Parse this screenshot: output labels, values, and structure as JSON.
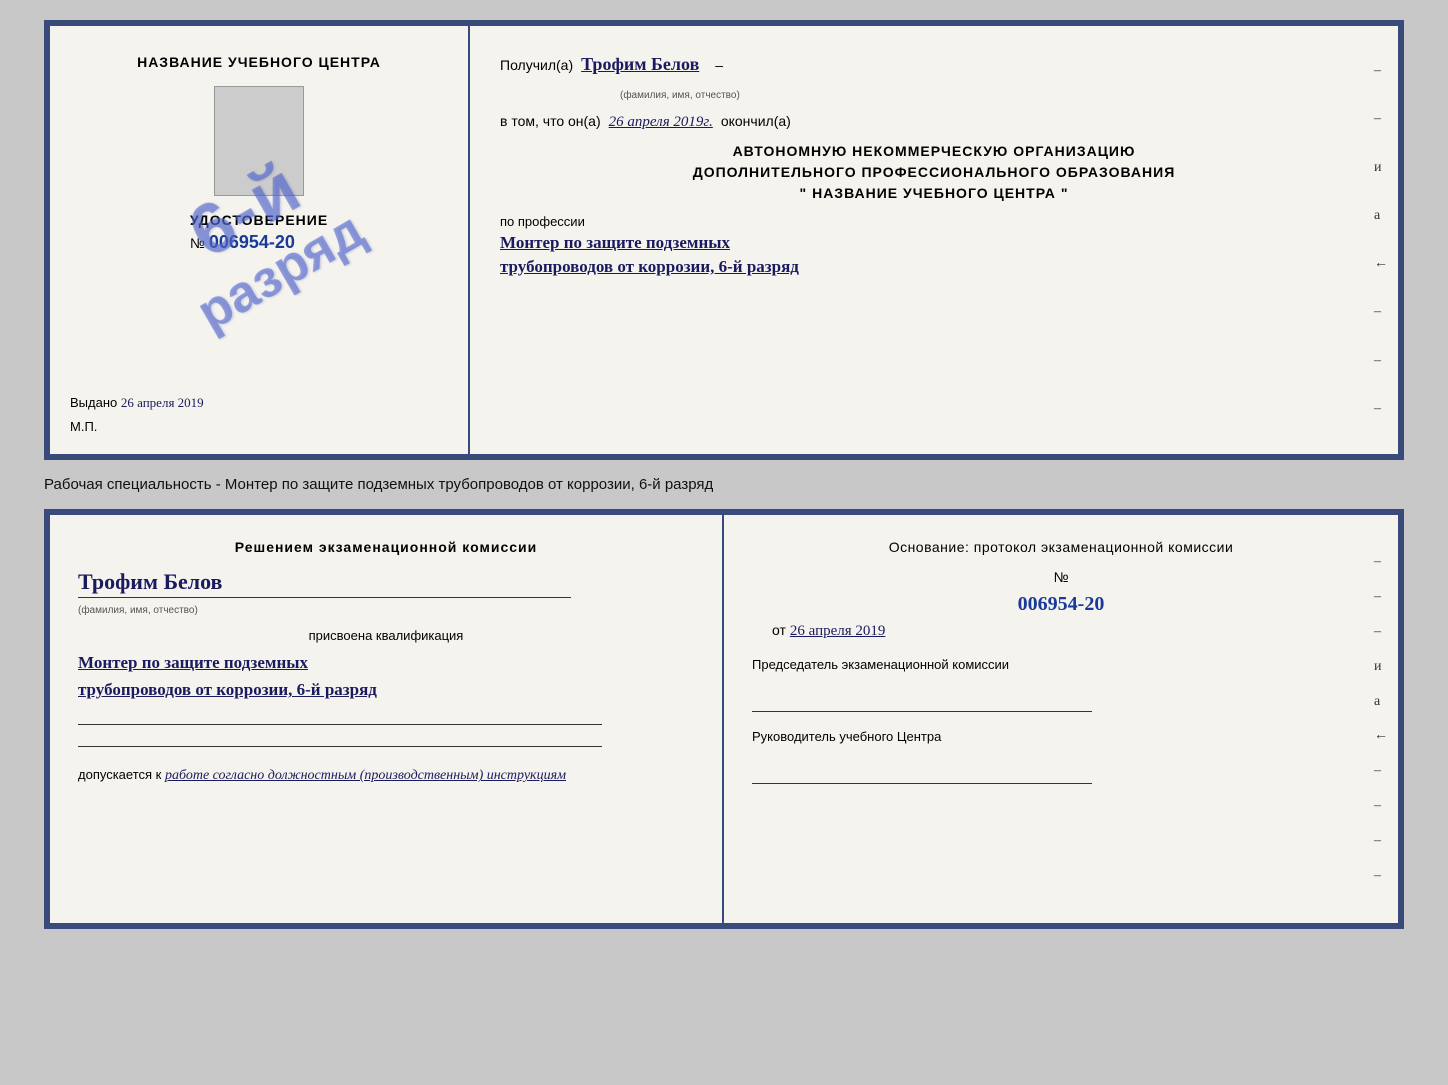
{
  "top_cert": {
    "left": {
      "title": "НАЗВАНИЕ УЧЕБНОГО ЦЕНТРА",
      "udost_title": "УДОСТОВЕРЕНИЕ",
      "udost_no_prefix": "№",
      "udost_no": "006954-20",
      "vydano_label": "Выдано",
      "vydano_date": "26 апреля 2019",
      "mp_label": "М.П."
    },
    "stamp": {
      "line1": "6-й",
      "line2": "разряд"
    },
    "right": {
      "poluchil_label": "Получил(а)",
      "recipient_name": "Трофим Белов",
      "fio_label": "(фамилия, имя, отчество)",
      "vtom_label": "в том, что он(а)",
      "date_value": "26 апреля 2019г.",
      "okonchil_label": "окончил(а)",
      "org_line1": "АВТОНОМНУЮ НЕКОММЕРЧЕСКУЮ ОРГАНИЗАЦИЮ",
      "org_line2": "ДОПОЛНИТЕЛЬНОГО ПРОФЕССИОНАЛЬНОГО ОБРАЗОВАНИЯ",
      "org_quote": "\"",
      "org_name": "НАЗВАНИЕ УЧЕБНОГО ЦЕНТРА",
      "org_quote2": "\"",
      "po_professii": "по профессии",
      "profession_line1": "Монтер по защите подземных",
      "profession_line2": "трубопроводов от коррозии, 6-й разряд"
    }
  },
  "middle": {
    "text": "Рабочая специальность - Монтер по защите подземных трубопроводов от коррозии, 6-й разряд"
  },
  "bottom_cert": {
    "left": {
      "title": "Решением  экзаменационной  комиссии",
      "name": "Трофим Белов",
      "fio_label": "(фамилия, имя, отчество)",
      "prisvoyena": "присвоена квалификация",
      "qualification_line1": "Монтер по защите подземных",
      "qualification_line2": "трубопроводов от коррозии, 6-й разряд",
      "dopusk_prefix": "допускается к",
      "dopusk_text": "работе согласно должностным (производственным) инструкциям"
    },
    "right": {
      "osnovaniye": "Основание: протокол экзаменационной  комиссии",
      "no_prefix": "№",
      "protocol_no": "006954-20",
      "ot_prefix": "от",
      "ot_date": "26 апреля 2019",
      "predsedatel_title": "Председатель экзаменационной комиссии",
      "rukovoditel_title": "Руководитель учебного Центра"
    }
  }
}
